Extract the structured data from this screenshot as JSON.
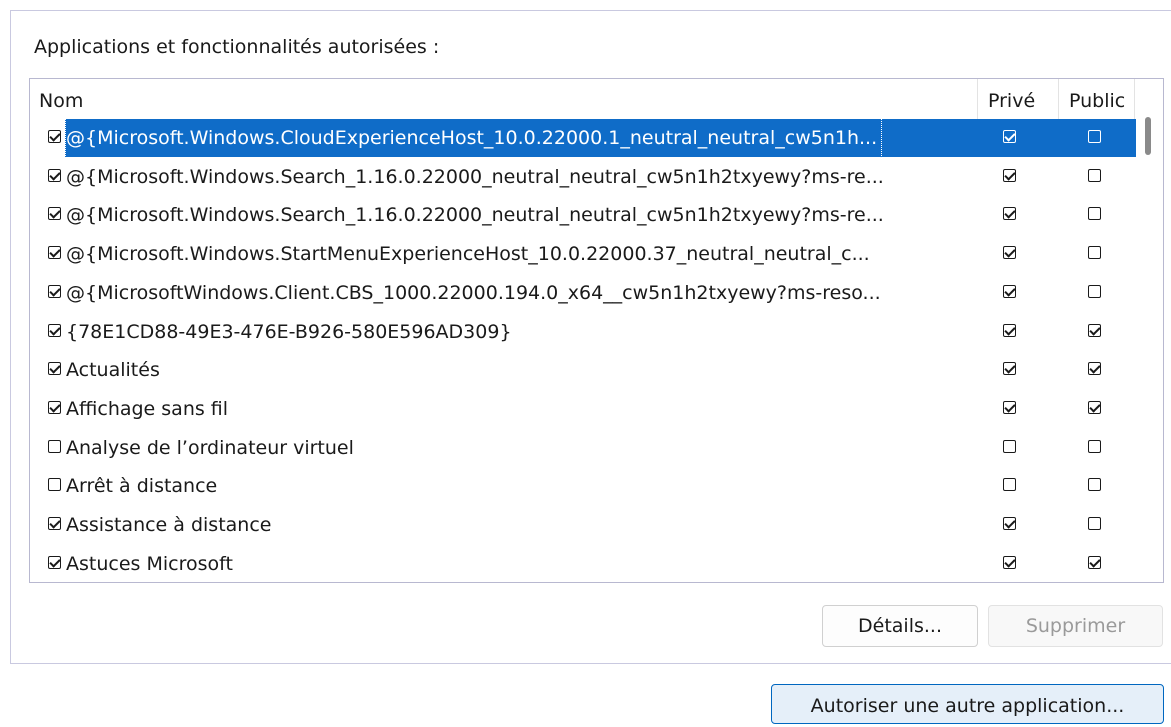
{
  "group": {
    "label": "Applications et fonctionnalités autorisées :"
  },
  "table": {
    "headers": {
      "name": "Nom",
      "prive": "Privé",
      "public": "Public"
    },
    "rows": [
      {
        "name": "@{Microsoft.Windows.CloudExperienceHost_10.0.22000.1_neutral_neutral_cw5n1h...",
        "enabled": true,
        "prive": true,
        "public": false,
        "selected": true
      },
      {
        "name": "@{Microsoft.Windows.Search_1.16.0.22000_neutral_neutral_cw5n1h2txyewy?ms-re...",
        "enabled": true,
        "prive": true,
        "public": false,
        "selected": false
      },
      {
        "name": "@{Microsoft.Windows.Search_1.16.0.22000_neutral_neutral_cw5n1h2txyewy?ms-re...",
        "enabled": true,
        "prive": true,
        "public": false,
        "selected": false
      },
      {
        "name": "@{Microsoft.Windows.StartMenuExperienceHost_10.0.22000.37_neutral_neutral_c...",
        "enabled": true,
        "prive": true,
        "public": false,
        "selected": false
      },
      {
        "name": "@{MicrosoftWindows.Client.CBS_1000.22000.194.0_x64__cw5n1h2txyewy?ms-reso...",
        "enabled": true,
        "prive": true,
        "public": false,
        "selected": false
      },
      {
        "name": "{78E1CD88-49E3-476E-B926-580E596AD309}",
        "enabled": true,
        "prive": true,
        "public": true,
        "selected": false
      },
      {
        "name": "Actualités",
        "enabled": true,
        "prive": true,
        "public": true,
        "selected": false
      },
      {
        "name": "Affichage sans fil",
        "enabled": true,
        "prive": true,
        "public": true,
        "selected": false
      },
      {
        "name": "Analyse de l’ordinateur virtuel",
        "enabled": false,
        "prive": false,
        "public": false,
        "selected": false
      },
      {
        "name": "Arrêt à distance",
        "enabled": false,
        "prive": false,
        "public": false,
        "selected": false
      },
      {
        "name": "Assistance à distance",
        "enabled": true,
        "prive": true,
        "public": false,
        "selected": false
      },
      {
        "name": "Astuces Microsoft",
        "enabled": true,
        "prive": true,
        "public": true,
        "selected": false
      }
    ]
  },
  "buttons": {
    "details": "Détails...",
    "supprimer": "Supprimer",
    "autoriser": "Autoriser une autre application..."
  },
  "colors": {
    "selection": "#0f6cc8",
    "accent_border": "#0067c0"
  }
}
